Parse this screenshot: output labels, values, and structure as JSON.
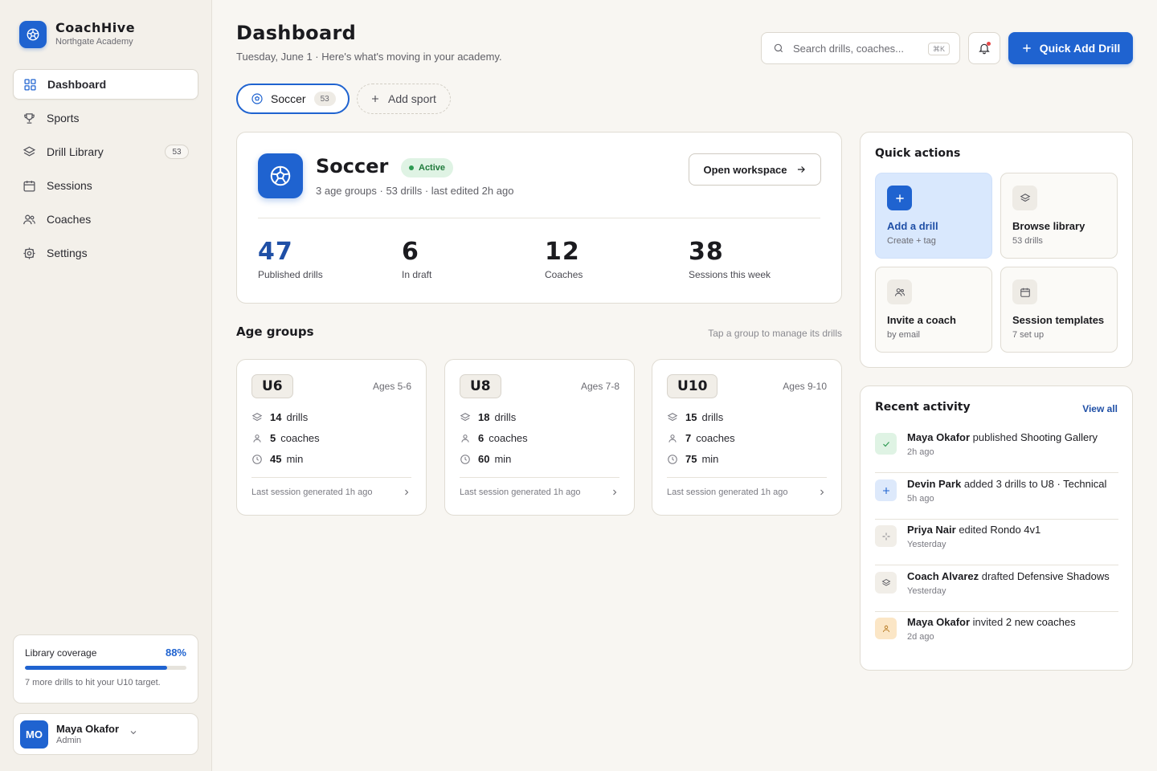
{
  "brand": {
    "name": "CoachHive",
    "subtitle": "Northgate Academy"
  },
  "nav": [
    {
      "label": "Dashboard",
      "icon": "grid-icon",
      "active": true
    },
    {
      "label": "Sports",
      "icon": "trophy-icon"
    },
    {
      "label": "Drill Library",
      "icon": "layers-icon",
      "badge": "53"
    },
    {
      "label": "Sessions",
      "icon": "calendar-icon"
    },
    {
      "label": "Coaches",
      "icon": "users-icon"
    },
    {
      "label": "Settings",
      "icon": "gear-icon"
    }
  ],
  "coverage": {
    "label": "Library coverage",
    "percent": "88%",
    "fill": 0.88,
    "note": "7 more drills to hit your U10 target."
  },
  "user": {
    "initials": "MO",
    "name": "Maya Okafor",
    "role": "Admin"
  },
  "header": {
    "title": "Dashboard",
    "subtitle": "Tuesday, June 1 · Here's what's moving in your academy.",
    "search_placeholder": "Search drills, coaches...",
    "search_shortcut": "⌘K",
    "quick_add_label": "Quick Add Drill"
  },
  "sport_tabs": {
    "active_label": "Soccer",
    "active_count": "53",
    "add_label": "Add sport"
  },
  "sport_card": {
    "title": "Soccer",
    "status": "Active",
    "meta": "3 age groups · 53 drills · last edited 2h ago",
    "open_label": "Open workspace",
    "stats": [
      {
        "value": "47",
        "label": "Published drills"
      },
      {
        "value": "6",
        "label": "In draft"
      },
      {
        "value": "12",
        "label": "Coaches"
      },
      {
        "value": "38",
        "label": "Sessions this week"
      }
    ]
  },
  "age_groups": {
    "title": "Age groups",
    "hint": "Tap a group to manage its drills",
    "groups": [
      {
        "tag": "U6",
        "ages": "Ages 5-6",
        "drills": "14",
        "coaches": "5",
        "minutes": "45",
        "footer": "Last session generated 1h ago"
      },
      {
        "tag": "U8",
        "ages": "Ages 7-8",
        "drills": "18",
        "coaches": "6",
        "minutes": "60",
        "footer": "Last session generated 1h ago"
      },
      {
        "tag": "U10",
        "ages": "Ages 9-10",
        "drills": "15",
        "coaches": "7",
        "minutes": "75",
        "footer": "Last session generated 1h ago"
      }
    ],
    "units": {
      "drills": "drills",
      "coaches": "coaches",
      "minutes": "min"
    }
  },
  "quick_actions": {
    "title": "Quick actions",
    "tiles": [
      {
        "name": "Add a drill",
        "desc": "Create + tag",
        "icon": "plus-icon"
      },
      {
        "name": "Browse library",
        "desc": "53 drills",
        "icon": "layers-icon"
      },
      {
        "name": "Invite a coach",
        "desc": "by email",
        "icon": "users-icon"
      },
      {
        "name": "Session templates",
        "desc": "7 set up",
        "icon": "calendar-icon"
      }
    ]
  },
  "recent_activity": {
    "title": "Recent activity",
    "view_all": "View all",
    "items": [
      {
        "actor": "Maya Okafor",
        "verb": " published ",
        "object": "Shooting Gallery",
        "time": "2h ago",
        "icon": "check-icon",
        "color": "#dff3e4"
      },
      {
        "actor": "Devin Park",
        "verb": " added 3 drills to ",
        "object": "U8 · Technical",
        "time": "5h ago",
        "icon": "plus-icon",
        "color": "#dde9fb"
      },
      {
        "actor": "Priya Nair",
        "verb": " edited ",
        "object": "Rondo 4v1",
        "time": "Yesterday",
        "icon": "sparkle-icon",
        "color": "#f1eee8"
      },
      {
        "actor": "Coach Alvarez",
        "verb": " drafted ",
        "object": "Defensive Shadows",
        "time": "Yesterday",
        "icon": "layers-icon",
        "color": "#f1eee8"
      },
      {
        "actor": "Maya Okafor",
        "verb": " invited ",
        "object": "2 new coaches",
        "time": "2d ago",
        "icon": "user-icon",
        "color": "#fbe6c6"
      }
    ]
  }
}
